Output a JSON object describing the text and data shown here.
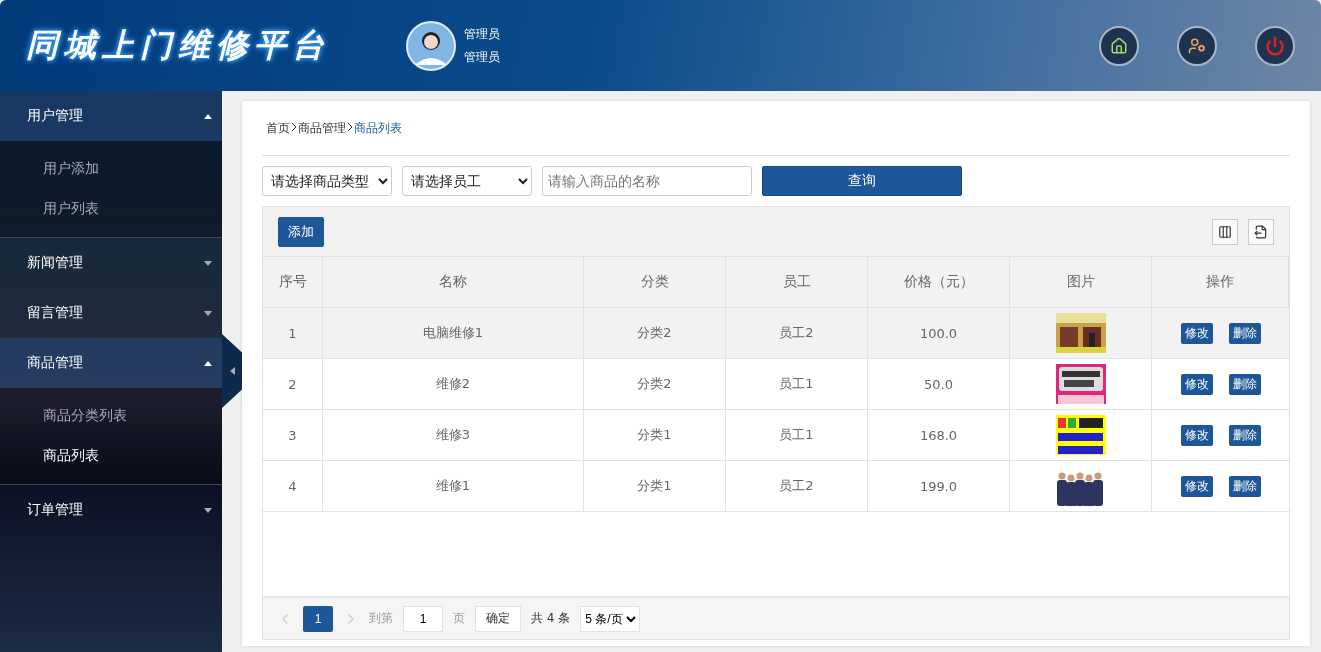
{
  "header": {
    "title": "同城上门维修平台",
    "user": {
      "name": "管理员",
      "role": "管理员"
    }
  },
  "sidebar": {
    "groups": [
      {
        "label": "用户管理",
        "expanded": true,
        "children": [
          {
            "label": "用户添加",
            "selected": false
          },
          {
            "label": "用户列表",
            "selected": false
          }
        ]
      },
      {
        "label": "新闻管理",
        "expanded": false
      },
      {
        "label": "留言管理",
        "expanded": false
      },
      {
        "label": "商品管理",
        "expanded": true,
        "children": [
          {
            "label": "商品分类列表",
            "selected": false
          },
          {
            "label": "商品列表",
            "selected": true
          }
        ]
      },
      {
        "label": "订单管理",
        "expanded": false
      }
    ]
  },
  "breadcrumb": [
    {
      "label": "首页",
      "current": false
    },
    {
      "label": "商品管理",
      "current": false
    },
    {
      "label": "商品列表",
      "current": true
    }
  ],
  "filters": {
    "category_select": "请选择商品类型",
    "staff_select": "请选择员工",
    "search": {
      "placeholder": "请输入商品的名称"
    },
    "query_button": "查询"
  },
  "toolbar": {
    "add_button": "添加"
  },
  "table": {
    "columns": [
      "序号",
      "名称",
      "分类",
      "员工",
      "价格（元）",
      "图片",
      "操作"
    ],
    "rows": [
      {
        "index": "1",
        "name": "电脑维修1",
        "category": "分类2",
        "staff": "员工2",
        "price": "100.0",
        "selected": true,
        "actions": [
          "修改",
          "删除"
        ]
      },
      {
        "index": "2",
        "name": "维修2",
        "category": "分类2",
        "staff": "员工1",
        "price": "50.0",
        "selected": false,
        "actions": [
          "修改",
          "删除"
        ]
      },
      {
        "index": "3",
        "name": "维修3",
        "category": "分类1",
        "staff": "员工1",
        "price": "168.0",
        "selected": false,
        "actions": [
          "修改",
          "删除"
        ]
      },
      {
        "index": "4",
        "name": "维修1",
        "category": "分类1",
        "staff": "员工2",
        "price": "199.0",
        "selected": false,
        "actions": [
          "修改",
          "删除"
        ]
      }
    ]
  },
  "pager": {
    "pages": [
      {
        "label": "1",
        "selected": true
      }
    ],
    "goto_label": "到第",
    "goto_value": "1",
    "page_unit": "页",
    "confirm": "确定",
    "total": "共 4 条",
    "page_size": "5 条/页"
  }
}
